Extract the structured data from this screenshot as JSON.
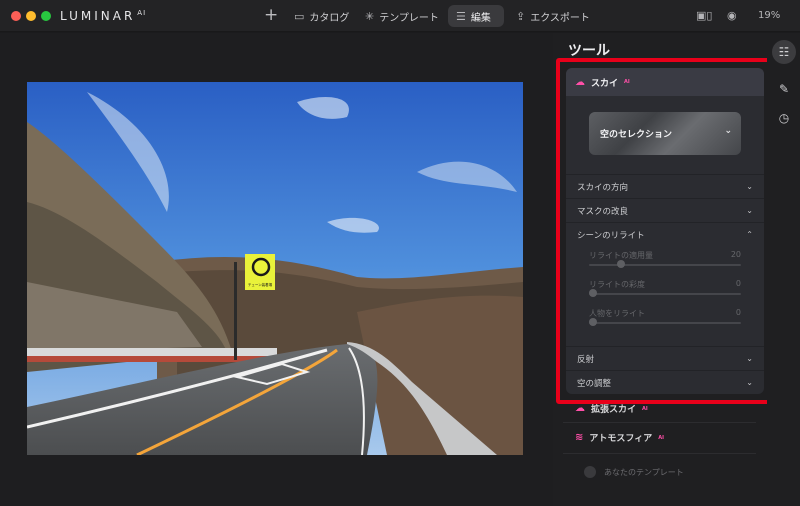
{
  "app": {
    "logo": "LUMINAR",
    "logo_suffix": "AI"
  },
  "nav": {
    "add_label": "+",
    "catalog": "カタログ",
    "templates": "テンプレート",
    "edit": "編集",
    "export": "エクスポート"
  },
  "zoom": "19%",
  "panel": {
    "title": "ツール",
    "sky": {
      "title": "スカイ",
      "badge": "AI",
      "selection_label": "空のセレクション",
      "sections": [
        "スカイの方向",
        "マスクの改良",
        "シーンのリライト",
        "反射",
        "空の調整"
      ],
      "sliders": [
        {
          "label": "リライトの適用量",
          "value": "20",
          "fraction": 0.2
        },
        {
          "label": "リライトの彩度",
          "value": "0",
          "fraction": 0
        },
        {
          "label": "人物をリライト",
          "value": "0",
          "fraction": 0
        }
      ]
    },
    "below": [
      {
        "label": "拡張スカイ",
        "badge": "AI"
      },
      {
        "label": "アトモスフィア",
        "badge": "AI"
      }
    ],
    "your_templates": "あなたのテンプレート"
  },
  "sign": {
    "caption": "チェーン装着場"
  },
  "colors": {
    "accent_pink": "#ff4fa8",
    "highlight_red": "#e8001a",
    "active_tab": "#3a3a3d"
  }
}
